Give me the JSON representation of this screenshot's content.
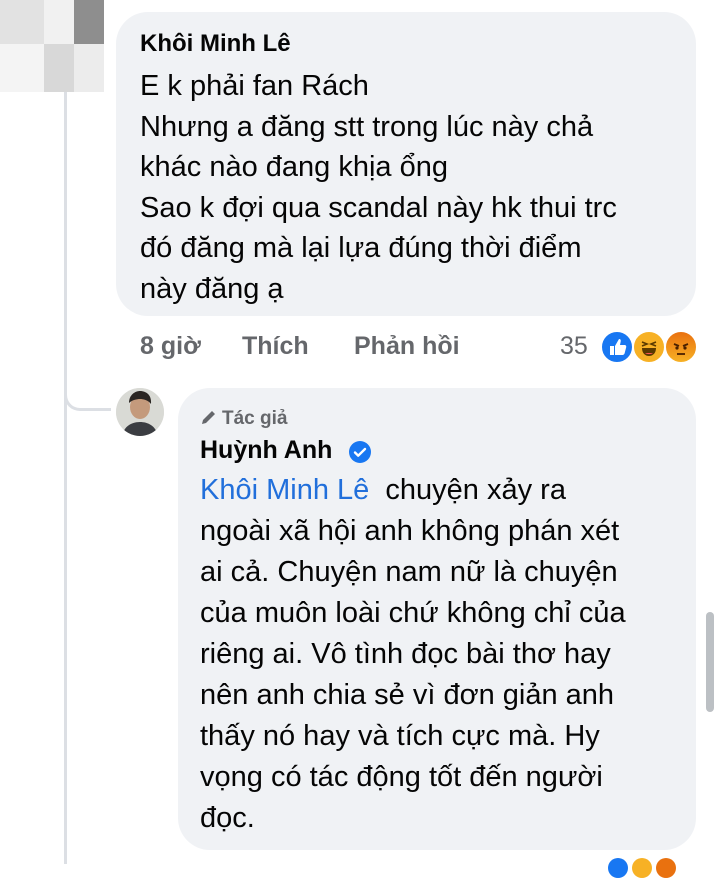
{
  "comment": {
    "author": "Khôi Minh Lê",
    "text_lines": [
      "E k phải fan Rách",
      "Nhưng a đăng stt trong lúc này chả",
      "khác nào đang khịa ổng",
      "Sao k đợi qua scandal này hk thui trc",
      "đó đăng mà lại lựa đúng thời điểm",
      "này đăng ạ"
    ],
    "actions": {
      "time": "8 giờ",
      "like": "Thích",
      "reply": "Phản hồi"
    },
    "reactions": {
      "count": "35",
      "icons": [
        "like-icon",
        "haha-icon",
        "angry-icon"
      ]
    }
  },
  "reply": {
    "badge": "Tác giả",
    "author": "Huỳnh Anh",
    "verified": true,
    "mention": "Khôi Minh Lê",
    "text_lines": [
      "chuyện xảy ra",
      "ngoài xã hội anh không phán xét",
      "ai cả. Chuyện nam nữ là chuyện",
      "của muôn loài chứ không chỉ của",
      "riêng ai. Vô tình đọc bài thơ hay",
      "nên anh chia sẻ vì đơn giản anh",
      "thấy nó hay và tích cực mà. Hy",
      "vọng có tác động tốt đến người",
      "đọc."
    ]
  },
  "colors": {
    "bubble": "#f0f2f5",
    "mention": "#216fdb",
    "meta": "#65676b",
    "verified": "#1877f2"
  }
}
